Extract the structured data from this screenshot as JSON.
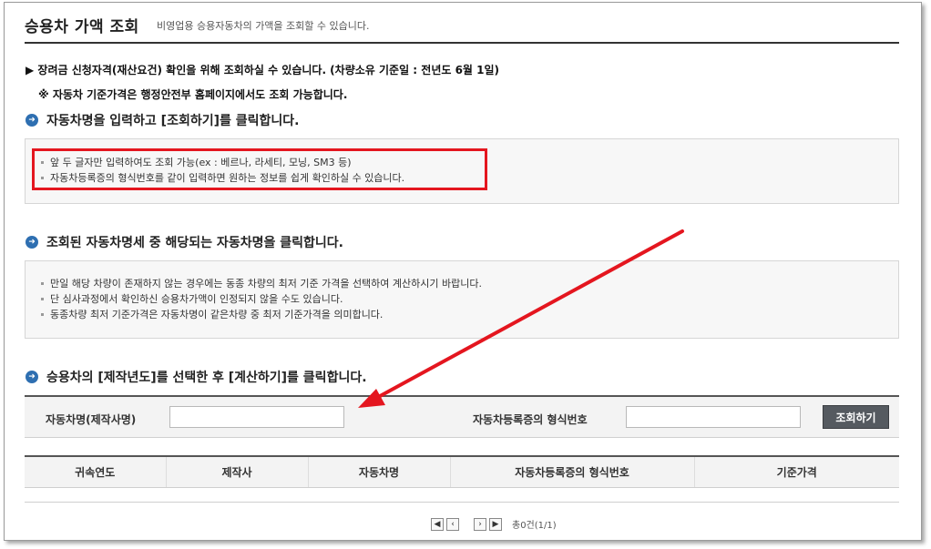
{
  "header": {
    "title": "승용차 가액 조회",
    "subtitle": "비영업용 승용자동차의 가액을 조회할 수 있습니다."
  },
  "notices": {
    "line1": "▶ 장려금 신청자격(재산요건) 확인을 위해 조회하실 수 있습니다. (차량소유 기준일 : 전년도 6월 1일)",
    "line2": "※ 자동차 기준가격은 행정안전부 홈페이지에서도 조회 가능합니다."
  },
  "steps": {
    "step1": "자동차명을 입력하고 [조회하기]를 클릭합니다.",
    "step2": "조회된 자동차명세 중 해당되는 자동차명을 클릭합니다.",
    "step3": "승용차의 [제작년도]를 선택한 후 [계산하기]를 클릭합니다."
  },
  "info_box_1": [
    "앞 두 글자만 입력하여도 조회 가능(ex : 베르나, 라세티, 모닝, SM3 등)",
    "자동차등록증의 형식번호를 같이 입력하면 원하는 정보를 쉽게 확인하실 수 있습니다."
  ],
  "info_box_2": [
    "만일 해당 차량이 존재하지 않는 경우에는 동종 차량의 최저 기준 가격을 선택하여 계산하시기 바랍니다.",
    "단 심사과정에서 확인하신 승용차가액이 인정되지 않을 수도 있습니다.",
    "동종차량 최저 기준가격은 자동차명이 같은차량 중  최저 기준가격을 의미합니다."
  ],
  "search": {
    "name_label": "자동차명(제작사명)",
    "name_value": "",
    "type_label": "자동차등록증의 형식번호",
    "type_value": "",
    "button_label": "조회하기"
  },
  "table": {
    "columns": [
      "귀속연도",
      "제작사",
      "자동차명",
      "자동차등록증의 형식번호",
      "기준가격"
    ],
    "rows": []
  },
  "pagination": {
    "first": "◀",
    "prev": "‹",
    "next": "›",
    "last": "▶",
    "info": "총0건(1/1)"
  },
  "colors": {
    "highlight_border": "#e4161f",
    "step_bullet": "#2e6fb1",
    "button_bg": "#555a60"
  }
}
